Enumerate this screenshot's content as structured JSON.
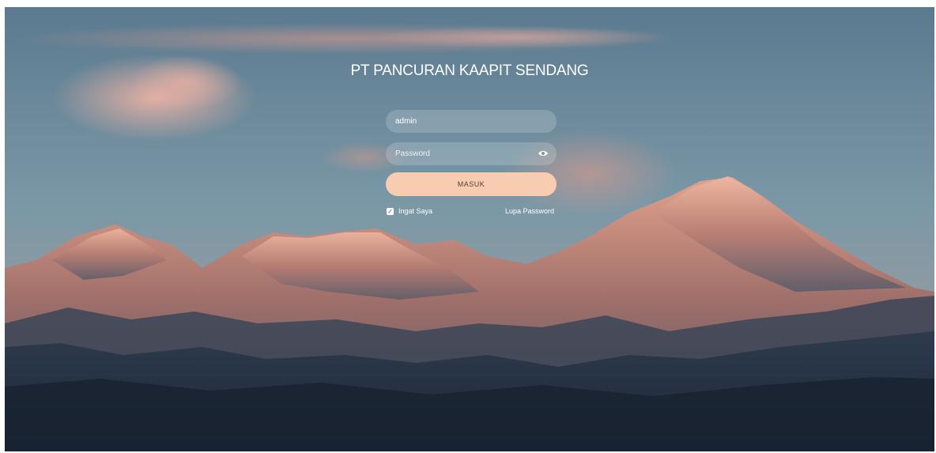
{
  "login": {
    "title": "PT PANCURAN KAAPIT SENDANG",
    "username_value": "admin",
    "password_placeholder": "Password",
    "submit_label": "MASUK",
    "remember_label": "Ingat Saya",
    "remember_checked": true,
    "forgot_label": "Lupa Password"
  },
  "icons": {
    "password_toggle": "eye-icon",
    "remember_check": "check-icon"
  },
  "colors": {
    "button": "#f7ccb1",
    "button_text": "#5b3f33",
    "text": "#ffffff"
  }
}
